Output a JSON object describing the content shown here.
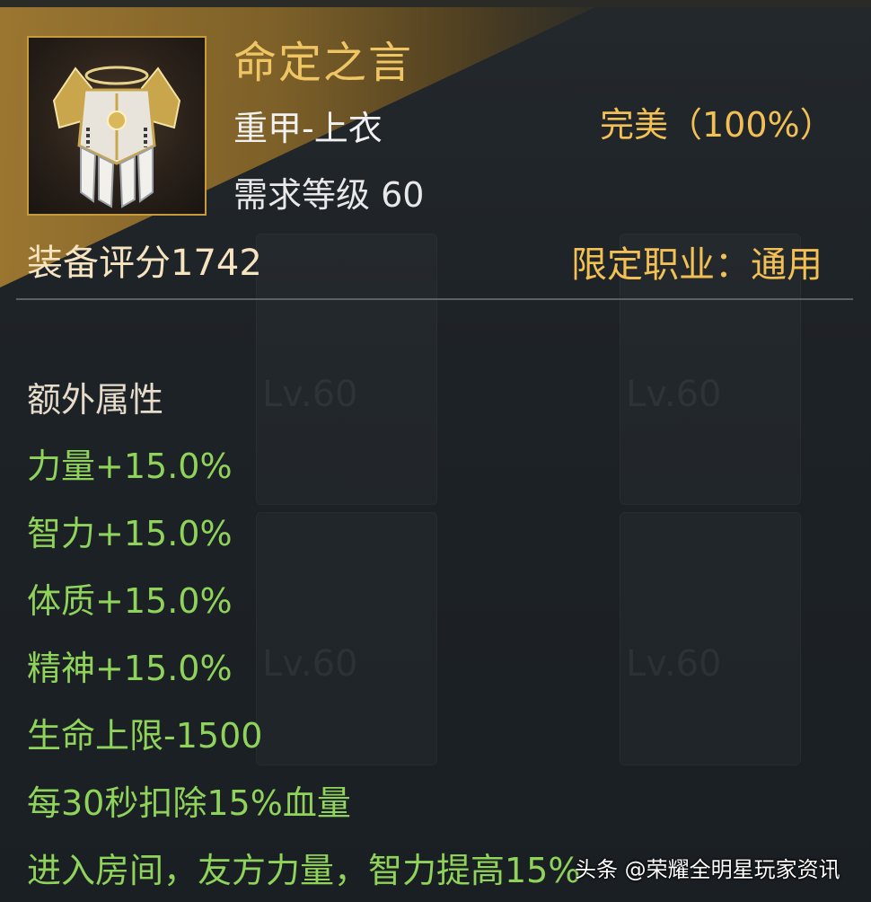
{
  "item": {
    "name": "命定之言",
    "type": "重甲-上衣",
    "level_requirement": "需求等级 60",
    "quality": "完美（100%）",
    "score": "装备评分1742",
    "class_restriction": "限定职业：通用",
    "icon": "heavy-armor-chest-icon"
  },
  "extra_attributes": {
    "title": "额外属性",
    "items": [
      "力量+15.0%",
      "智力+15.0%",
      "体质+15.0%",
      "精神+15.0%",
      "生命上限-1500",
      "每30秒扣除15%血量",
      "进入房间，友方力量，智力提高15%"
    ]
  },
  "background_ghost_labels": [
    "Lv.60",
    "Lv.60",
    "Lv.60",
    "Lv.60"
  ],
  "watermark": "头条 @荣耀全明星玩家资讯",
  "colors": {
    "name_gold": "#f0c665",
    "quality_gold": "#f3c054",
    "attr_green": "#8fd35a",
    "band_gold": "#a07a2c"
  }
}
